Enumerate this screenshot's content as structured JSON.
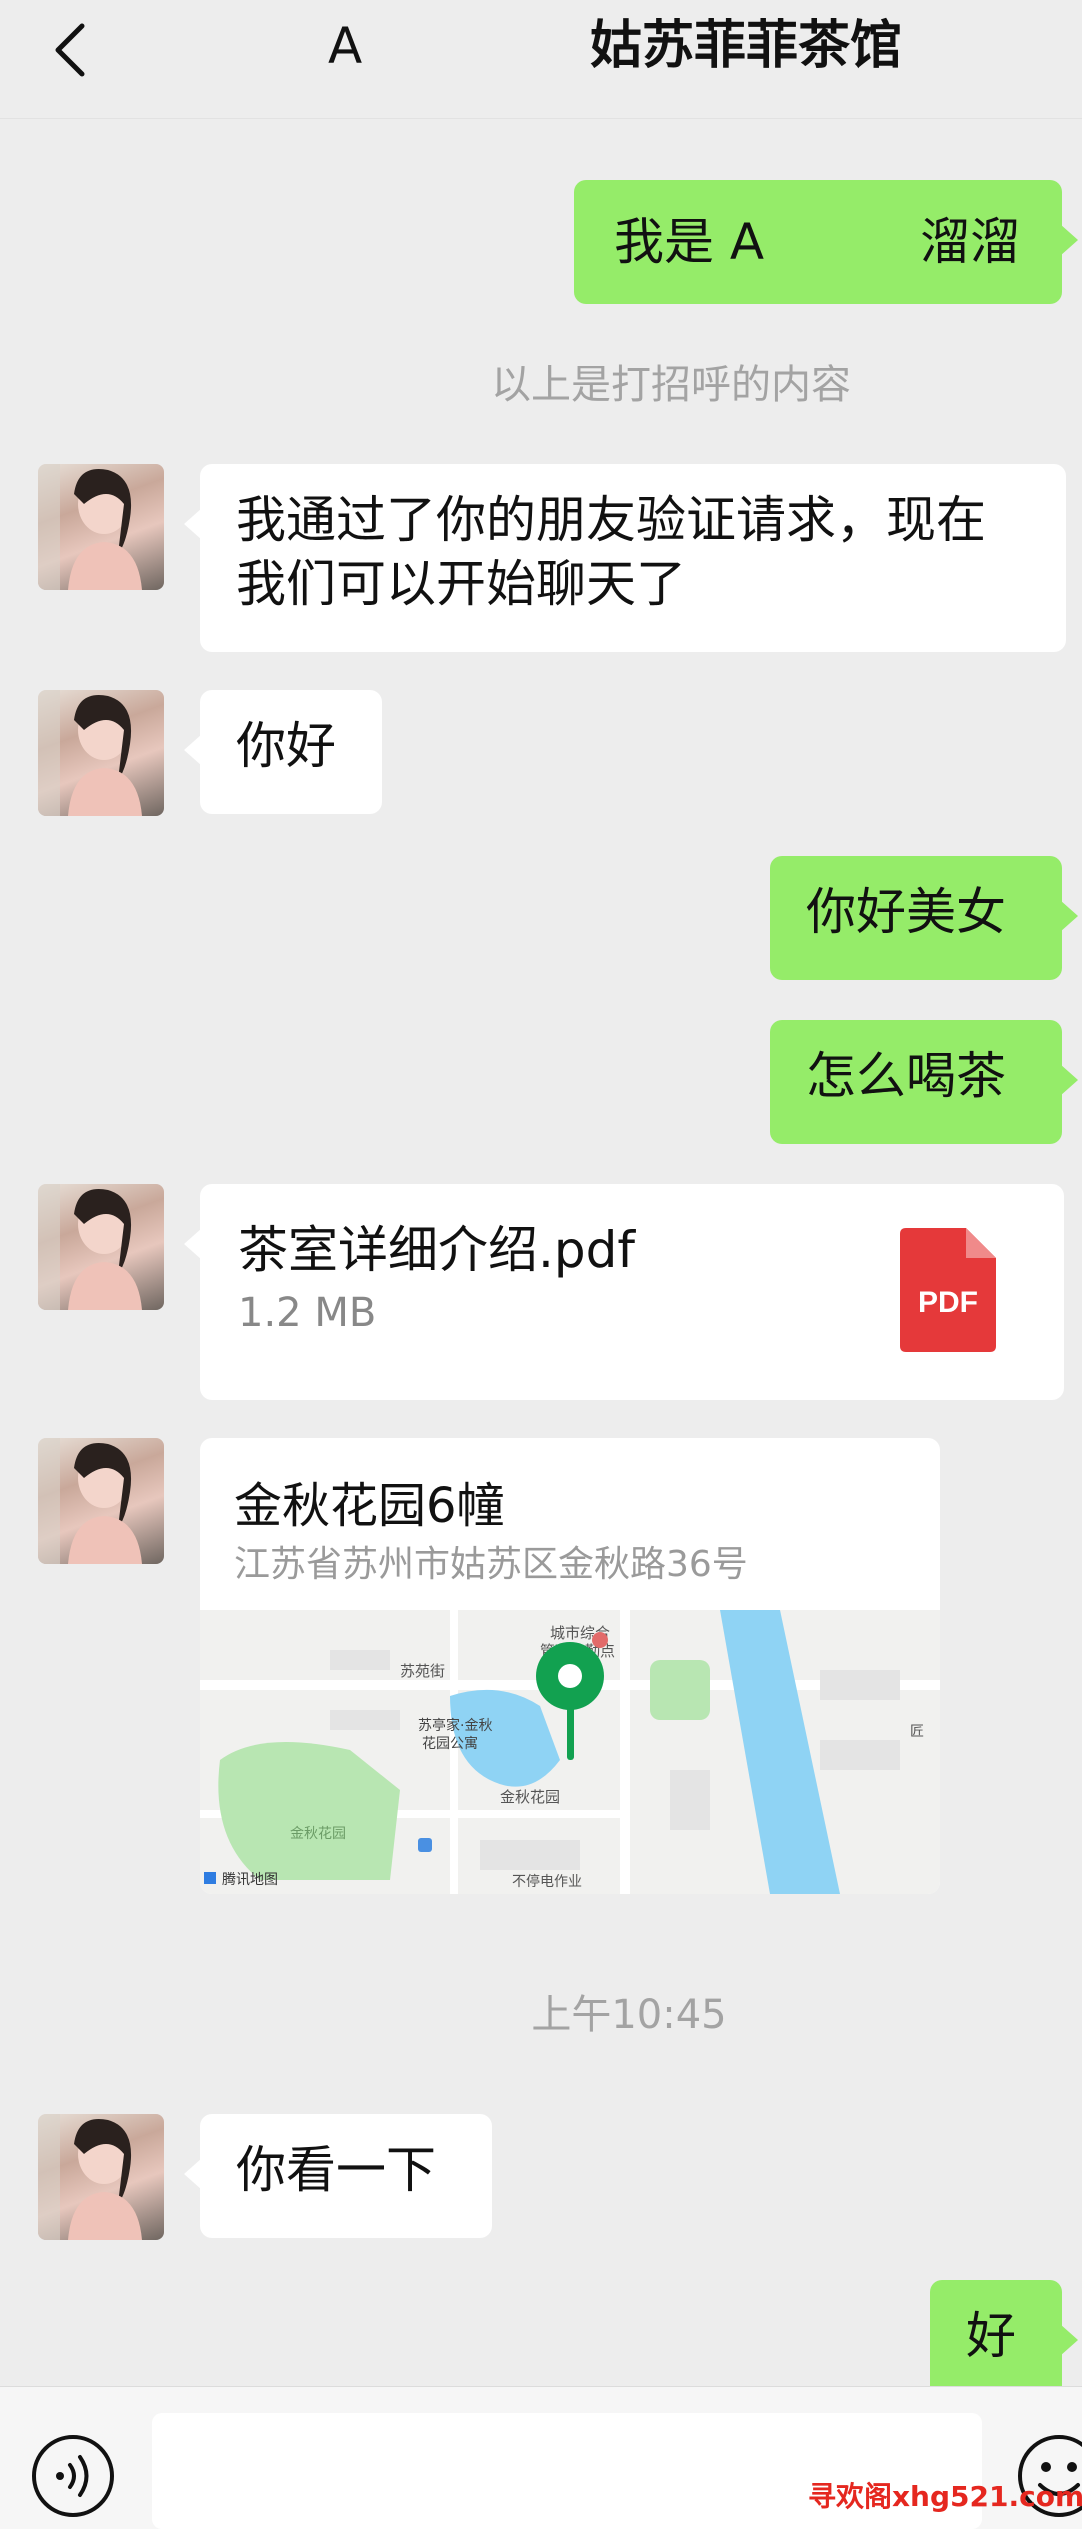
{
  "header": {
    "back_label": "<",
    "contact_name": "A",
    "group_name": "姑苏菲菲茶馆"
  },
  "messages": {
    "out_greeting_left": "我是 A",
    "out_greeting_right": "溜溜",
    "system_greeting": "以上是打招呼的内容",
    "in_friend_accept_line1": "我通过了你的朋友验证请求，现在",
    "in_friend_accept_line2": "我们可以开始聊天了",
    "in_hello": "你好",
    "out_hello": "你好美女",
    "out_tea": "怎么喝茶",
    "file": {
      "name": "茶室详细介绍.pdf",
      "size": "1.2 MB",
      "badge": "PDF"
    },
    "location": {
      "name": "金秋花园6幢",
      "address": "江苏省苏州市姑苏区金秋路36号",
      "map_labels": {
        "poi_city": "城市综合",
        "poi_city2": "管理执勤点",
        "street": "苏苑街",
        "poi_apt1": "苏亭家·金秋",
        "poi_apt2": "花园公寓",
        "garden": "金秋花园",
        "garden2": "金秋花园",
        "work": "不停电作业",
        "map_brand": "腾讯地图",
        "right_label": "匠"
      }
    },
    "time_stamp": "上午10:45",
    "in_look": "你看一下",
    "out_ok": "好"
  },
  "toolbar": {
    "voice_icon": "voice-icon",
    "emoji_icon": "emoji-icon"
  },
  "watermark": "寻欢阁xhg521.com",
  "colors": {
    "background": "#ededed",
    "outgoing_bubble": "#95ec69",
    "incoming_bubble": "#ffffff",
    "pdf_red": "#e5393a",
    "map_pin": "#12a150"
  }
}
